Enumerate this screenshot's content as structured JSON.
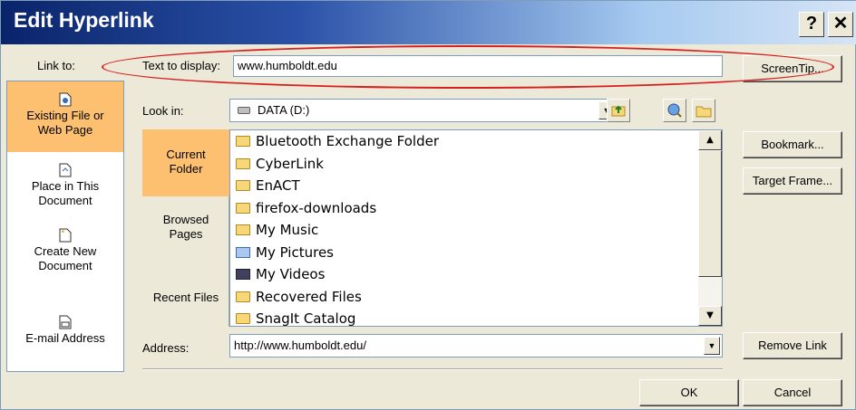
{
  "dialog": {
    "title": "Edit Hyperlink",
    "help_label": "?",
    "close_label": "✕"
  },
  "link_to": {
    "label": "Link to:",
    "items": [
      {
        "label_line1": "Existing File or",
        "label_line2": "Web Page",
        "icon": "existing-file-icon",
        "selected": true
      },
      {
        "label_line1": "Place in This",
        "label_line2": "Document",
        "icon": "place-in-document-icon",
        "selected": false
      },
      {
        "label_line1": "Create New",
        "label_line2": "Document",
        "icon": "new-document-icon",
        "selected": false
      },
      {
        "label_line1": "E-mail Address",
        "label_line2": "",
        "icon": "email-icon",
        "selected": false
      }
    ]
  },
  "text_to_display": {
    "label": "Text to display:",
    "value": "www.humboldt.edu"
  },
  "screentip_button": "ScreenTip...",
  "look_in": {
    "label": "Look in:",
    "value": "DATA (D:)"
  },
  "folder_nav": {
    "items": [
      {
        "line1": "Current",
        "line2": "Folder",
        "selected": true
      },
      {
        "line1": "Browsed",
        "line2": "Pages",
        "selected": false
      },
      {
        "line1": "Recent Files",
        "line2": "",
        "selected": false
      }
    ]
  },
  "files": [
    {
      "name": "Bluetooth Exchange Folder",
      "icon": "folder-icon"
    },
    {
      "name": "CyberLink",
      "icon": "folder-icon"
    },
    {
      "name": "EnACT",
      "icon": "folder-icon"
    },
    {
      "name": "firefox-downloads",
      "icon": "folder-icon"
    },
    {
      "name": "My Music",
      "icon": "music-folder-icon"
    },
    {
      "name": "My Pictures",
      "icon": "pictures-folder-icon"
    },
    {
      "name": "My Videos",
      "icon": "videos-folder-icon"
    },
    {
      "name": "Recovered Files",
      "icon": "folder-icon"
    },
    {
      "name": "SnagIt Catalog",
      "icon": "folder-icon"
    }
  ],
  "side_buttons": {
    "bookmark": "Bookmark...",
    "target_frame": "Target Frame...",
    "remove_link": "Remove Link"
  },
  "address": {
    "label": "Address:",
    "value": "http://www.humboldt.edu/"
  },
  "footer": {
    "ok": "OK",
    "cancel": "Cancel"
  },
  "colors": {
    "selected_item": "#fcc070",
    "annotation": "#d62020",
    "title_bar": "#0a246a"
  }
}
